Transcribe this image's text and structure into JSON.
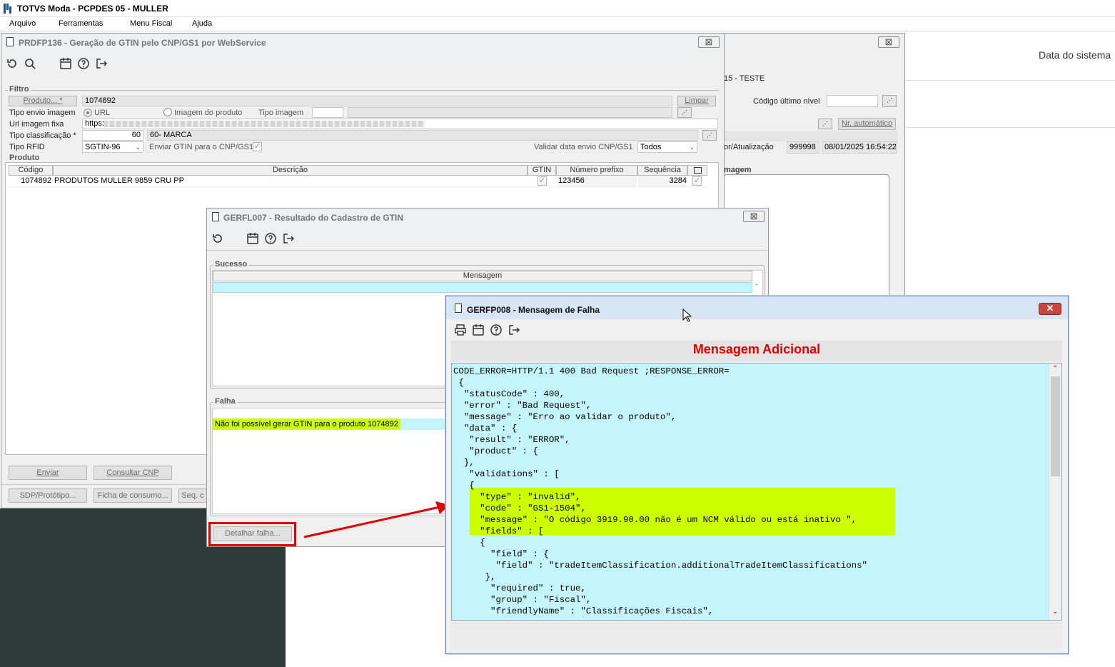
{
  "app": {
    "title": "TOTVS Moda - PCPDES 05 - MULLER",
    "menu": [
      "Arquivo",
      "Ferramentas",
      "Menu Fiscal",
      "Ajuda"
    ]
  },
  "bg": {
    "date_label": "Data do sistema",
    "teste": "15 - TESTE",
    "codigo_ultimo_nivel": "Código último nível",
    "nr_automatico": "Nr. automático",
    "atualizacao_label": "or/Atualização",
    "atualizacao_user": "999998",
    "atualizacao_date": "08/01/2025 16:54:22",
    "imagem_label": "magem"
  },
  "prdfp136": {
    "title": "PRDFP136 - Geração de GTIN pelo CNP/GS1 por WebService",
    "filtro_label": "Filtro",
    "produto_btn": "Produto... *",
    "produto_value": "1074892",
    "limpar": "Limpar",
    "tipo_envio_label": "Tipo envio imagem",
    "radio_url": "URL",
    "radio_imagem": "Imagem do produto",
    "tipo_imagem_label": "Tipo imagem",
    "url_label": "Url imagem fixa",
    "url_value": "https:",
    "tipo_class_label": "Tipo classificação *",
    "tipo_class_value": "60",
    "tipo_class_desc": "60- MARCA",
    "tipo_rfid_label": "Tipo RFID",
    "tipo_rfid_value": "SGTIN-96",
    "enviar_gtin_label": "Enviar GTIN para o CNP/GS1",
    "validar_label": "Validar data envio CNP/GS1",
    "validar_value": "Todos",
    "produto_label": "Produto",
    "columns": [
      "Código",
      "Descrição",
      "GTIN",
      "Número prefixo",
      "Sequência"
    ],
    "row": {
      "codigo": "1074892",
      "descricao": "PRODUTOS MULLER 9859 CRU PP",
      "prefixo": "123456",
      "sequencia": "3284"
    },
    "btn_enviar": "Enviar",
    "btn_consultar": "Consultar CNP",
    "btn_sdp": "SDP/Protótipo...",
    "btn_ficha": "Ficha de consumo...",
    "btn_seq": "Seq. c"
  },
  "gerfl007": {
    "title": "GERFL007 - Resultado do Cadastro de GTIN",
    "sucesso_label": "Sucesso",
    "mensagem_col": "Mensagem",
    "falha_label": "Falha",
    "falha_msg": "Não foi possível gerar GTIN para o produto 1074892",
    "detalhar_btn": "Detalhar falha..."
  },
  "gerfp008": {
    "title": "GERFP008 - Mensagem de Falha",
    "heading": "Mensagem Adicional",
    "message_lines": [
      "CODE_ERROR=HTTP/1.1 400 Bad Request ;RESPONSE_ERROR=",
      " {",
      "  \"statusCode\" : 400,",
      "  \"error\" : \"Bad Request\",",
      "  \"message\" : \"Erro ao validar o produto\",",
      "  \"data\" : {",
      "   \"result\" : \"ERROR\",",
      "   \"product\" : {",
      "  },",
      "   \"validations\" : [",
      "   {",
      "     \"type\" : \"invalid\",",
      "     \"code\" : \"GS1-1504\",",
      "     \"message\" : \"O código 3919.90.00 não é um NCM válido ou está inativo \",",
      "     \"fields\" : [",
      "     {",
      "       \"field\" : {",
      "        \"field\" : \"tradeItemClassification.additionalTradeItemClassifications\"",
      "      },",
      "       \"required\" : true,",
      "       \"group\" : \"Fiscal\",",
      "       \"friendlyName\" : \"Classificações Fiscais\","
    ]
  },
  "colors": {
    "highlight_yellow": "#ccff00",
    "text_bg": "#c4f4fc",
    "heading_red": "#e00000",
    "annotation_red": "#e00000"
  }
}
